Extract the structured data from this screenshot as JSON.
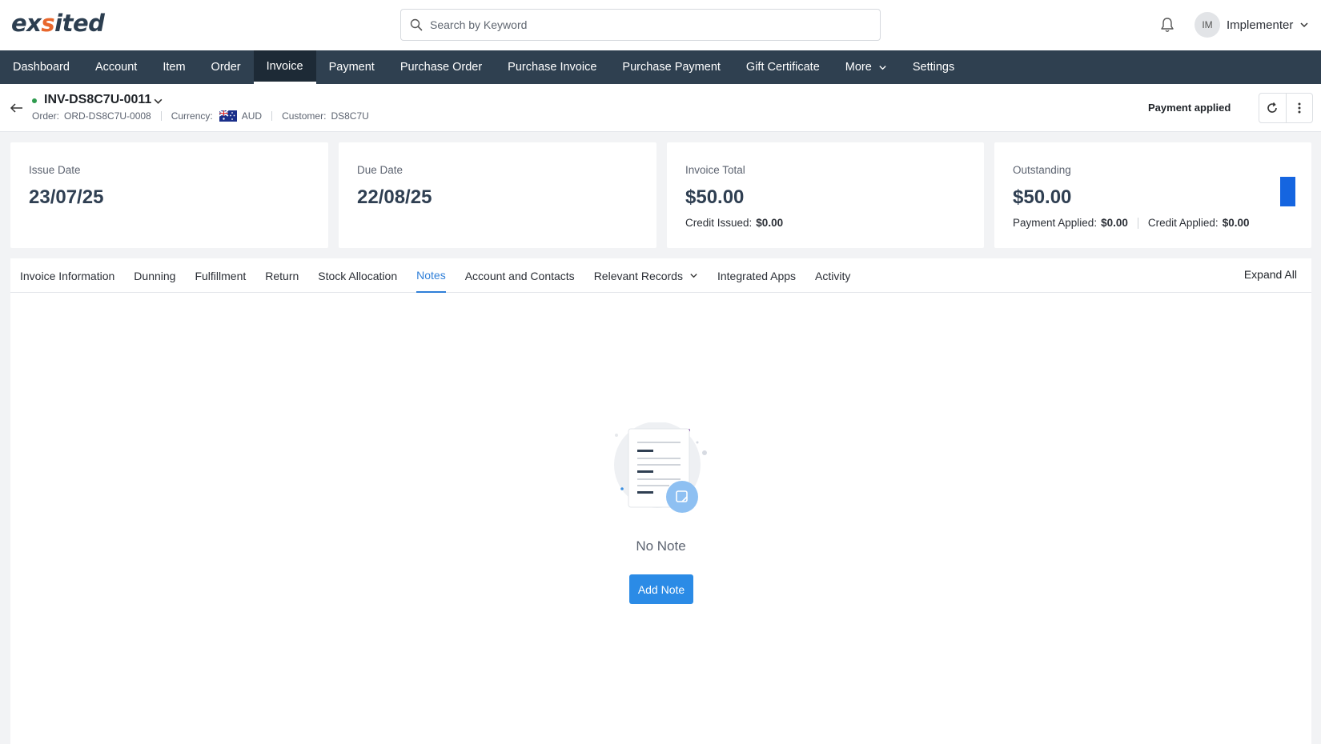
{
  "header": {
    "logo_prefix": "ex",
    "logo_accent": "s",
    "logo_suffix": "ited",
    "search_placeholder": "Search by Keyword",
    "user_initials": "IM",
    "user_name": "Implementer"
  },
  "nav": {
    "items": [
      {
        "label": "Dashboard"
      },
      {
        "label": "Account"
      },
      {
        "label": "Item"
      },
      {
        "label": "Order"
      },
      {
        "label": "Invoice",
        "active": true
      },
      {
        "label": "Payment"
      },
      {
        "label": "Purchase Order"
      },
      {
        "label": "Purchase Invoice"
      },
      {
        "label": "Purchase Payment"
      },
      {
        "label": "Gift Certificate"
      },
      {
        "label": "More"
      },
      {
        "label": "Settings"
      }
    ]
  },
  "record": {
    "id": "INV-DS8C7U-0011",
    "order_label": "Order:",
    "order_value": "ORD-DS8C7U-0008",
    "currency_label": "Currency:",
    "currency_value": "AUD",
    "customer_label": "Customer:",
    "customer_value": "DS8C7U",
    "payment_status": "Payment applied"
  },
  "summary": {
    "issue_label": "Issue Date",
    "issue_value": "23/07/25",
    "due_label": "Due Date",
    "due_value": "22/08/25",
    "total_label": "Invoice Total",
    "total_value": "$50.00",
    "credit_issued_label": "Credit Issued:",
    "credit_issued_value": "$0.00",
    "outstanding_label": "Outstanding",
    "outstanding_value": "$50.00",
    "payment_applied_label": "Payment Applied:",
    "payment_applied_value": "$0.00",
    "credit_applied_label": "Credit Applied:",
    "credit_applied_value": "$0.00"
  },
  "tabs": {
    "items": [
      {
        "label": "Invoice Information"
      },
      {
        "label": "Dunning"
      },
      {
        "label": "Fulfillment"
      },
      {
        "label": "Return"
      },
      {
        "label": "Stock Allocation"
      },
      {
        "label": "Notes",
        "active": true
      },
      {
        "label": "Account and Contacts"
      },
      {
        "label": "Relevant Records"
      },
      {
        "label": "Integrated Apps"
      },
      {
        "label": "Activity"
      }
    ],
    "expand_all": "Expand All"
  },
  "notes": {
    "empty_text": "No Note",
    "add_button": "Add Note"
  },
  "colors": {
    "nav_bg": "#2f4050",
    "accent": "#2b8be6",
    "logo_accent": "#e8672c",
    "status_ok": "#2e9b4e"
  }
}
